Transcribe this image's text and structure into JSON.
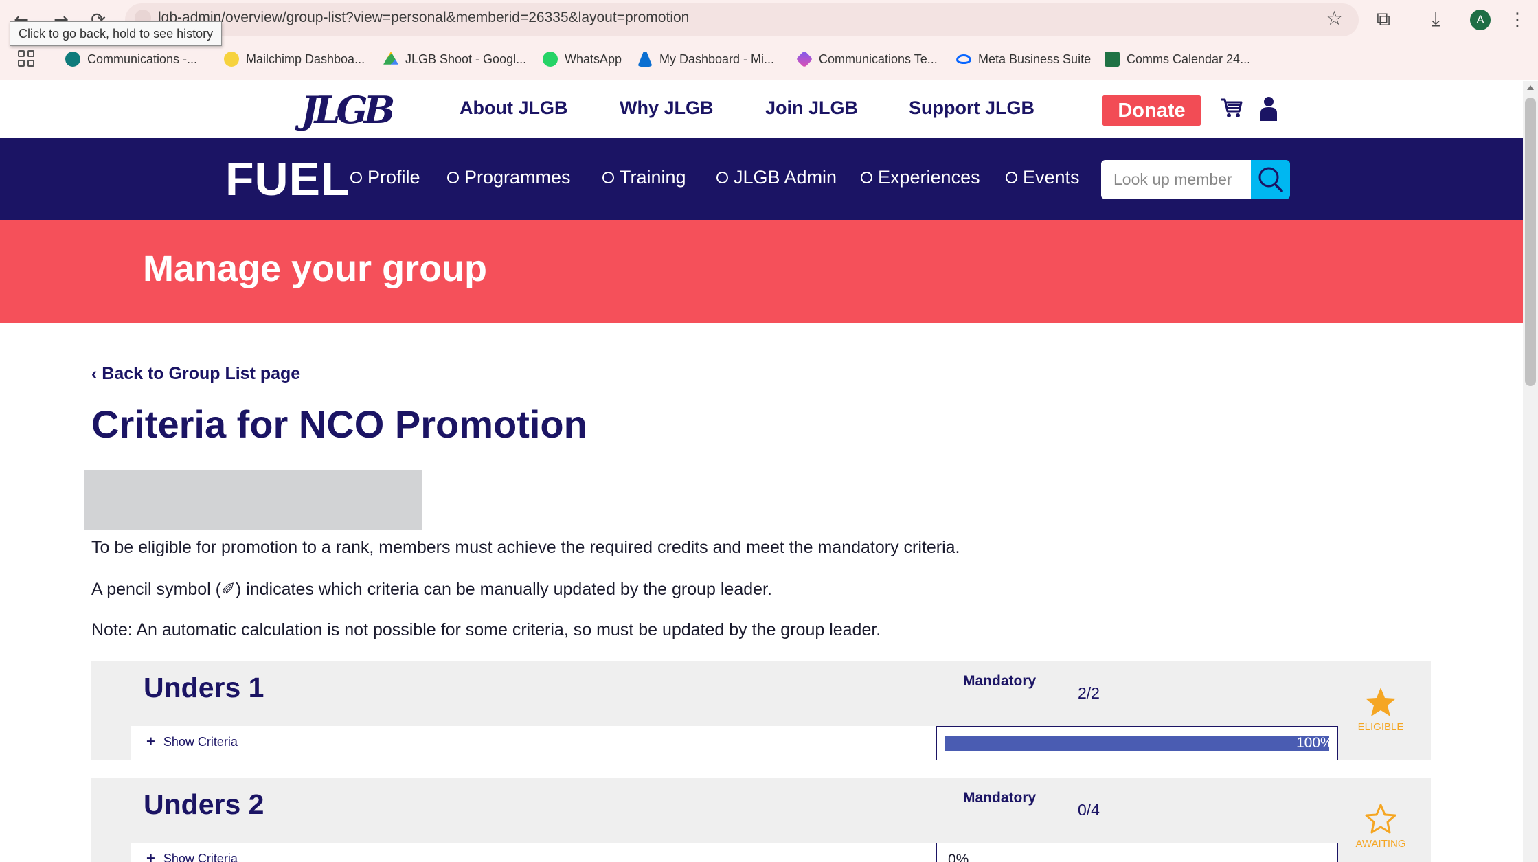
{
  "browser": {
    "url": "jlgb.org/jlgb-admin/overview/group-list?view=personal&memberid=26335&layout=promotion",
    "url_visible": "lgb-admin/overview/group-list?view=personal&memberid=26335&layout=promotion",
    "tooltip": "Click to go back, hold to see history",
    "avatar_letter": "A",
    "bookmarks": [
      {
        "label": "Communications -...",
        "icon": "sharepoint-icon",
        "color": "#0f7b7b"
      },
      {
        "label": "Mailchimp Dashboa...",
        "icon": "mailchimp-icon",
        "color": "#f6d23d"
      },
      {
        "label": "JLGB Shoot - Googl...",
        "icon": "google-drive-icon",
        "color": "#34a853"
      },
      {
        "label": "WhatsApp",
        "icon": "whatsapp-icon",
        "color": "#25d366"
      },
      {
        "label": "My Dashboard - Mi...",
        "icon": "azure-icon",
        "color": "#0a6ed1"
      },
      {
        "label": "Communications Te...",
        "icon": "loop-icon",
        "color": "#b845d6"
      },
      {
        "label": "Meta Business Suite",
        "icon": "meta-icon",
        "color": "#0866ff"
      },
      {
        "label": "Comms Calendar 24...",
        "icon": "excel-icon",
        "color": "#1f7244"
      }
    ]
  },
  "site": {
    "logo_text": "JLGB",
    "nav": [
      "About JLGB",
      "Why JLGB",
      "Join JLGB",
      "Support JLGB"
    ],
    "donate_label": "Donate"
  },
  "fuel": {
    "logo": "FUEL",
    "menu": [
      "Profile",
      "Programmes",
      "Training",
      "JLGB Admin",
      "Experiences",
      "Events"
    ],
    "search_placeholder": "Look up member"
  },
  "banner": {
    "title": "Manage your group"
  },
  "content": {
    "back_link": "‹ Back to Group List page",
    "title": "Criteria for NCO Promotion",
    "paragraphs": [
      "To be eligible for promotion to a rank, members must achieve the required credits and meet the mandatory criteria.",
      "A pencil symbol (✐) indicates which criteria can be manually updated by the group leader.",
      "Note: An automatic calculation is not possible for some criteria, so must be updated by the group leader."
    ],
    "ranks": [
      {
        "name": "Unders 1",
        "mandatory_label": "Mandatory",
        "mandatory_count": "2/2",
        "show_criteria": "Show Criteria",
        "progress_percent": 100,
        "progress_label": "100%",
        "status": "ELIGIBLE",
        "status_color": "#f5a623"
      },
      {
        "name": "Unders 2",
        "mandatory_label": "Mandatory",
        "mandatory_count": "0/4",
        "show_criteria": "Show Criteria",
        "progress_percent": 0,
        "progress_label": "0%",
        "status": "AWAITING",
        "status_color": "#f5a623"
      }
    ]
  },
  "colors": {
    "navy": "#1b1464",
    "coral": "#f5505a",
    "donate": "#f24c55",
    "search_button": "#00b7f1",
    "progress": "#4a5cb2"
  }
}
